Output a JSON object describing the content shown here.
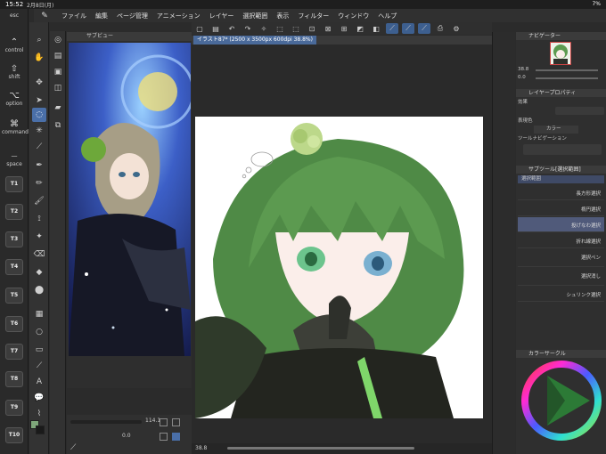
{
  "status": {
    "time": "15:52",
    "date": "2月8日(月)",
    "battery": "7%"
  },
  "menu": [
    "ファイル",
    "編集",
    "ページ管理",
    "アニメーション",
    "レイヤー",
    "選択範囲",
    "表示",
    "フィルター",
    "ウィンドウ",
    "ヘルプ"
  ],
  "keys": {
    "esc": "esc",
    "control": "control",
    "shift": "shift",
    "option": "option",
    "command": "command",
    "space": "space",
    "t_buttons": [
      "T1",
      "T2",
      "T3",
      "T4",
      "T5",
      "T6",
      "T7",
      "T8",
      "T9",
      "T10"
    ]
  },
  "subview": {
    "title": "サブビュー",
    "zoom": "114.1",
    "angle": "0.0"
  },
  "document": {
    "tab_title": "イラスト87* (2500 x 3500px 600dpi 38.8%)",
    "zoom": "38.8"
  },
  "navigator": {
    "title": "ナビゲーター",
    "zoom": "38.8",
    "angle": "0.0"
  },
  "layer_property": {
    "title": "レイヤープロパティ",
    "effect_label": "効果",
    "color_label": "表現色",
    "color_value": "カラー",
    "toolnav_label": "ツールナビゲーション"
  },
  "subtool": {
    "title": "サブツール[選択範囲]",
    "group": "選択範囲",
    "items": [
      "長方形選択",
      "楕円選択",
      "投げなわ選択",
      "折れ線選択",
      "選択ペン",
      "選択消し",
      "シュリンク選択"
    ]
  },
  "color_circle": {
    "title": "カラーサークル",
    "hue_color": "#2fa84a",
    "triangle_color": "#2c7a36"
  },
  "colors": {
    "accent": "#4a6fa8",
    "main_color": "#7ea67a",
    "sub_color": "#1a1a1a"
  }
}
